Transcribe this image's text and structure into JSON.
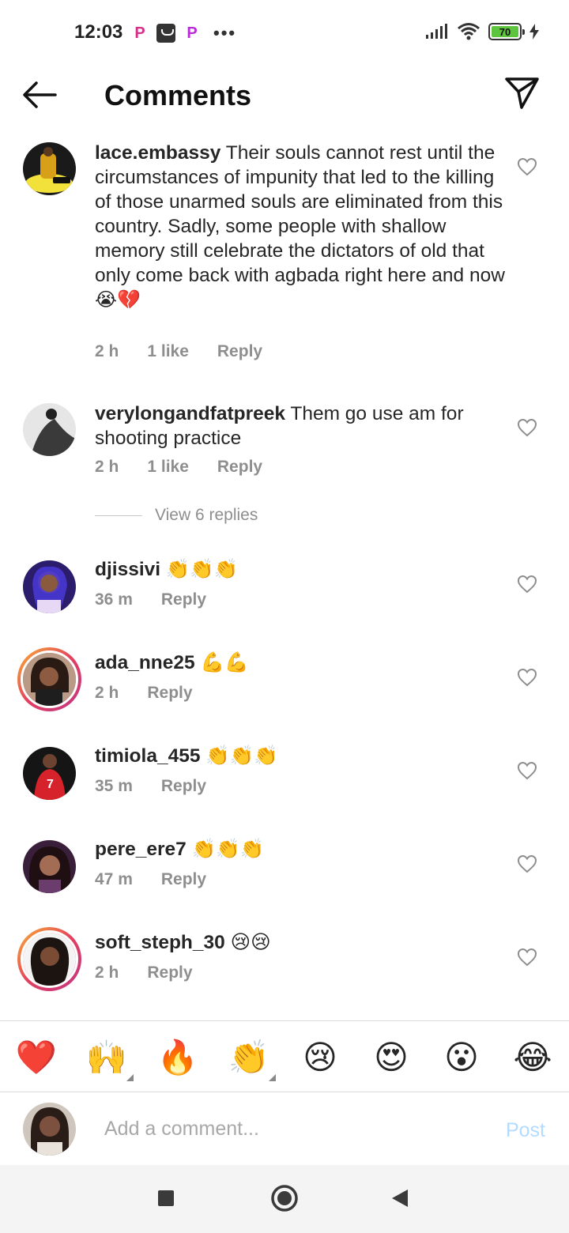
{
  "status_bar": {
    "time": "12:03",
    "battery": "70",
    "app_icons": [
      "p-app-icon",
      "bag-app-icon",
      "p-app-icon"
    ],
    "overflow": "•••"
  },
  "header": {
    "title": "Comments",
    "back_icon": "arrow-left-icon",
    "share_icon": "paper-plane-icon"
  },
  "comments": [
    {
      "username": "lace.embassy",
      "text": " Their souls cannot rest until the circumstances of impunity that led to the killing of those unarmed souls are eliminated from this country. Sadly, some people with shallow memory still celebrate the dictators of old that only come back with agbada right here and now",
      "emoji_line": "😭💔",
      "time": "2 h",
      "likes": "1 like",
      "reply": "Reply"
    },
    {
      "username": "verylongandfatpreek",
      "text": " Them go use am for shooting practice",
      "time": "2 h",
      "likes": "1 like",
      "reply": "Reply"
    },
    {
      "username": "djissivi",
      "text": " 👏👏👏",
      "time": "36 m",
      "reply": "Reply"
    },
    {
      "username": "ada_nne25",
      "text": " 💪💪",
      "time": "2 h",
      "reply": "Reply"
    },
    {
      "username": "timiola_455",
      "text": " 👏👏👏",
      "time": "35 m",
      "reply": "Reply"
    },
    {
      "username": "pere_ere7",
      "text": " 👏👏👏",
      "time": "47 m",
      "reply": "Reply"
    },
    {
      "username": "soft_steph_30",
      "text": " 😢😢",
      "time": "2 h",
      "reply": "Reply"
    }
  ],
  "view_replies": "View 6 replies",
  "emoji_bar": [
    "❤️",
    "🙌",
    "🔥",
    "👏",
    "😢",
    "😍",
    "😮",
    "😂"
  ],
  "composer": {
    "placeholder": "Add a comment...",
    "post_label": "Post"
  },
  "nav": {
    "recents_icon": "square-icon",
    "home_icon": "circle-icon",
    "back_icon": "triangle-back-icon"
  },
  "colors": {
    "accent_post": "#b3dbff",
    "meta_gray": "#8e8e8e",
    "battery_green": "#5cc43d"
  }
}
